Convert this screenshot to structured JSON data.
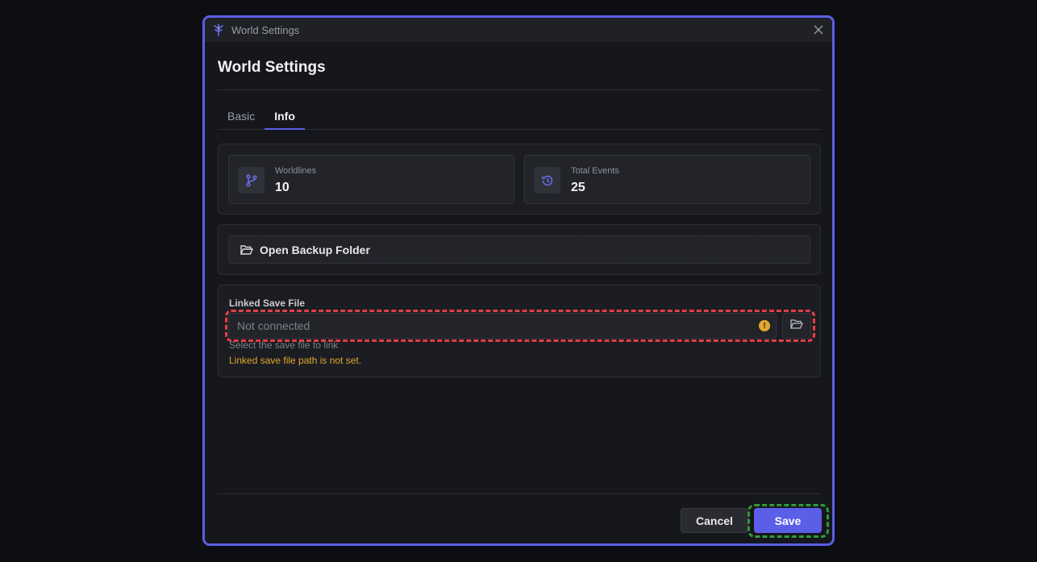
{
  "window": {
    "title": "World Settings",
    "app_icon": "app-logo-icon",
    "close_icon": "close-icon"
  },
  "dialog": {
    "heading": "World Settings",
    "accent_color": "#5b5ee6"
  },
  "tabs": [
    {
      "label": "Basic",
      "active": false
    },
    {
      "label": "Info",
      "active": true
    }
  ],
  "stats": [
    {
      "label": "Worldlines",
      "value": "10",
      "icon": "branch-icon"
    },
    {
      "label": "Total Events",
      "value": "25",
      "icon": "history-icon"
    }
  ],
  "backup": {
    "label": "Open Backup Folder",
    "icon": "folder-open-icon"
  },
  "linked_save": {
    "label": "Linked Save File",
    "placeholder": "Not connected",
    "value": "",
    "hint": "Select the save file to link",
    "error": "Linked save file path is not set.",
    "warning_icon": "warning-icon",
    "warning_color": "#e2a72e",
    "browse_icon": "folder-open-icon"
  },
  "footer": {
    "cancel_label": "Cancel",
    "save_label": "Save"
  }
}
